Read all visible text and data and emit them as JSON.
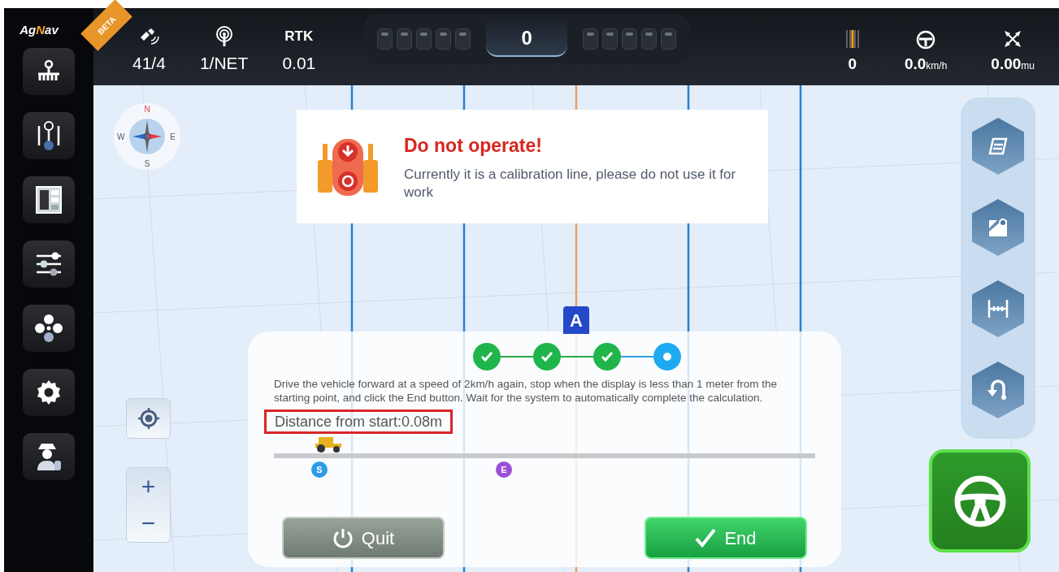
{
  "logo": {
    "prefix": "Ag",
    "accent": "N",
    "suffix": "av"
  },
  "badge": "BETA",
  "status_left": [
    {
      "kind": "satellite",
      "value": "41/4"
    },
    {
      "kind": "antenna",
      "value": "1/NET"
    },
    {
      "kind": "label",
      "label": "RTK",
      "value": "0.01"
    }
  ],
  "lightbar": {
    "left": [
      {
        "on": false
      },
      {
        "on": false
      },
      {
        "on": false
      },
      {
        "on": false
      },
      {
        "on": false
      }
    ],
    "value": "0",
    "right": [
      {
        "on": false
      },
      {
        "on": false
      },
      {
        "on": false
      },
      {
        "on": false
      },
      {
        "on": false
      }
    ]
  },
  "status_right": [
    {
      "kind": "offset",
      "value": "0"
    },
    {
      "kind": "speed",
      "value": "0.0",
      "unit": "km/h"
    },
    {
      "kind": "area",
      "value": "0.00",
      "unit": "mu"
    }
  ],
  "sidebar": {
    "items": [
      {
        "kind": "implement"
      },
      {
        "kind": "ab-line"
      },
      {
        "kind": "field-info"
      },
      {
        "kind": "sliders"
      },
      {
        "kind": "modules"
      },
      {
        "kind": "settings"
      },
      {
        "kind": "user"
      }
    ]
  },
  "compass": {
    "n": "N",
    "e": "E",
    "s": "S",
    "w": "W"
  },
  "vehicle_marker": "A",
  "alert": {
    "title": "Do not operate!",
    "message": "Currently it is a calibration line, please do not use it for work"
  },
  "wizard": {
    "steps": [
      {
        "done": true
      },
      {
        "done": true
      },
      {
        "done": true
      },
      {
        "done": false
      }
    ],
    "instruction": "Drive the vehicle forward at a speed of 2km/h again, stop when the display is less than 1 meter from the starting point, and click the End button. Wait for the system to automatically complete the calculation.",
    "distance": "Distance from start:0.08m",
    "track": {
      "level": 0.07,
      "start": "S",
      "end": "E"
    },
    "buttons": [
      {
        "kind": "quit",
        "label": "Quit"
      },
      {
        "kind": "end",
        "label": "End"
      }
    ]
  },
  "map_controls": {
    "zoom_in": "+",
    "zoom_out": "−"
  },
  "tools": [
    {
      "kind": "boundary"
    },
    {
      "kind": "map-pin"
    },
    {
      "kind": "width"
    },
    {
      "kind": "u-turn"
    }
  ]
}
